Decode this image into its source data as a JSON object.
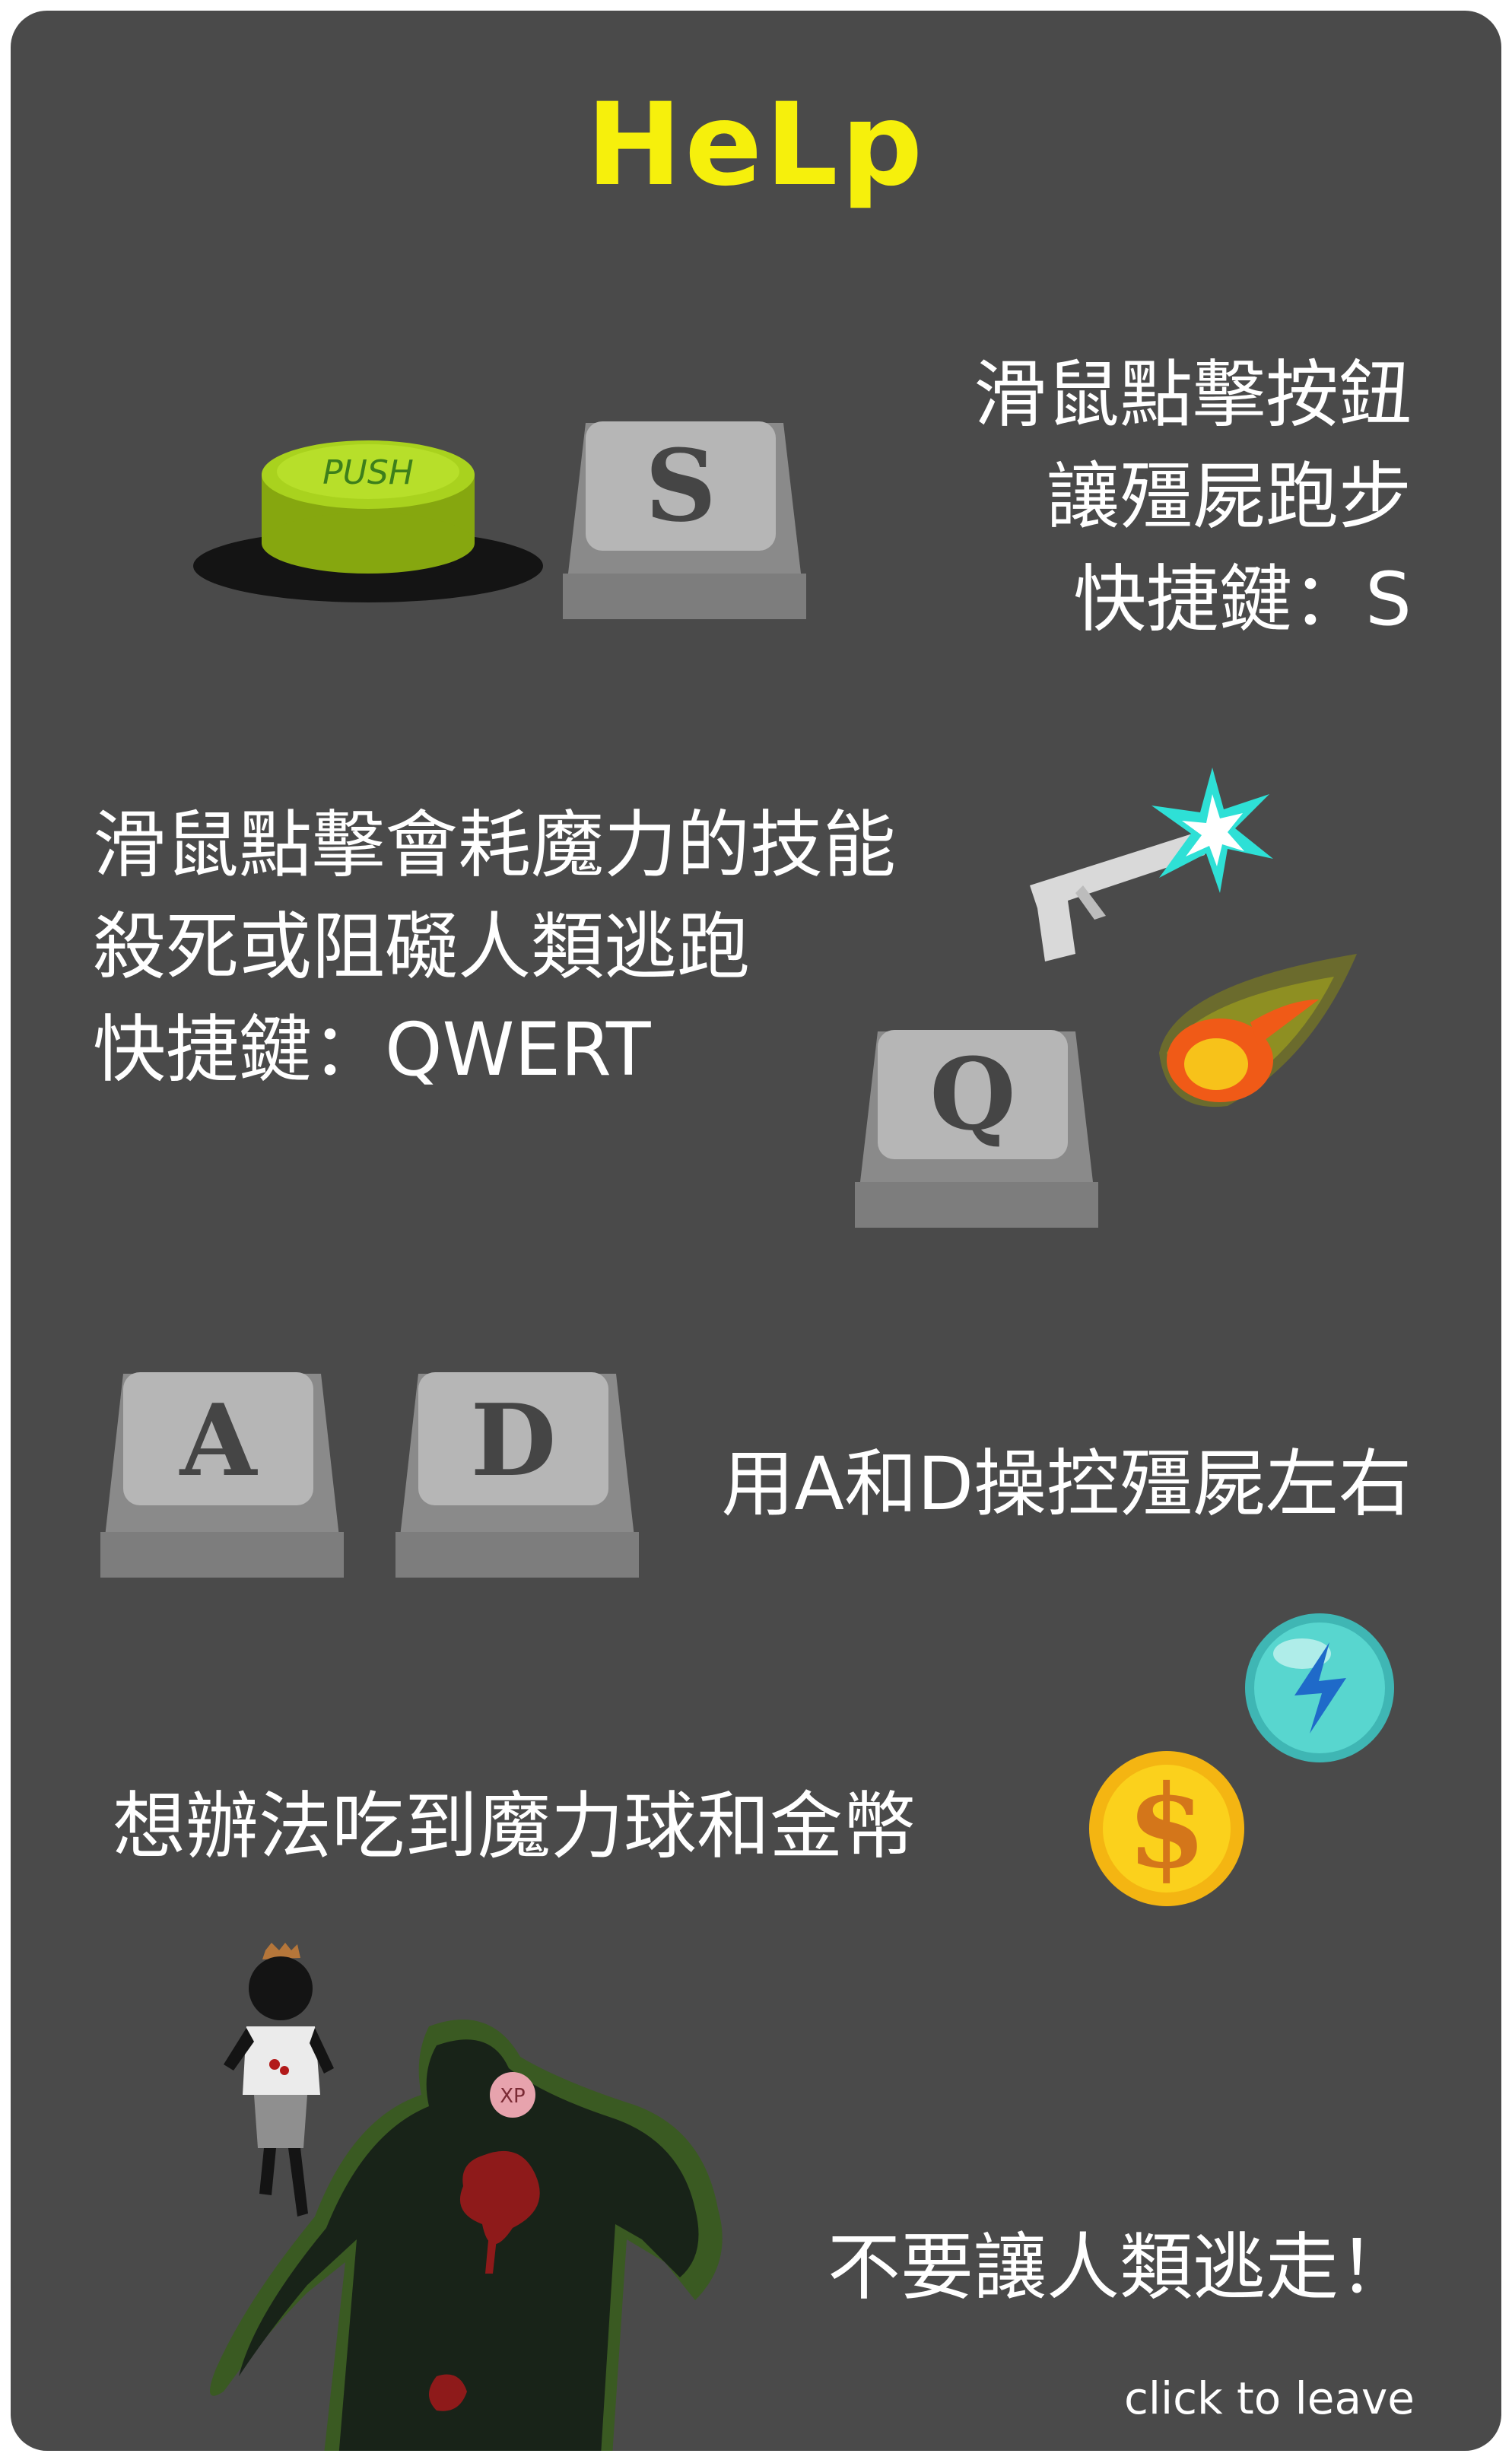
{
  "title": "HeLp",
  "sections": {
    "run": {
      "lines": [
        "滑鼠點擊按鈕",
        "讓殭屍跑步",
        "快捷鍵：S"
      ],
      "button_label": "PUSH",
      "key": "S"
    },
    "skills": {
      "lines": [
        "滑鼠點擊會耗魔力的技能",
        "殺死或阻礙人類逃跑",
        "快捷鍵：QWERT"
      ],
      "key": "Q"
    },
    "move": {
      "line": "用A和D操控殭屍左右",
      "keys": [
        "A",
        "D"
      ]
    },
    "collect": {
      "line": "想辦法吃到魔力球和金幣",
      "coin_symbol": "$"
    },
    "goal": {
      "line": "不要讓人類逃走！",
      "zombie_tag": "XP"
    }
  },
  "footer": {
    "leave_label": "click to leave"
  },
  "colors": {
    "panel": "#4a4a4a",
    "title": "#f6f00c",
    "text": "#ffffff",
    "button_green": "#9bc216",
    "key_gray": "#a5a5a5"
  },
  "icons": [
    "push-button-icon",
    "key-s-icon",
    "pistol-icon",
    "muzzle-flash-icon",
    "fireball-icon",
    "key-q-icon",
    "key-a-icon",
    "key-d-icon",
    "mana-orb-icon",
    "gold-coin-icon",
    "human-runner-icon",
    "zombie-icon"
  ]
}
